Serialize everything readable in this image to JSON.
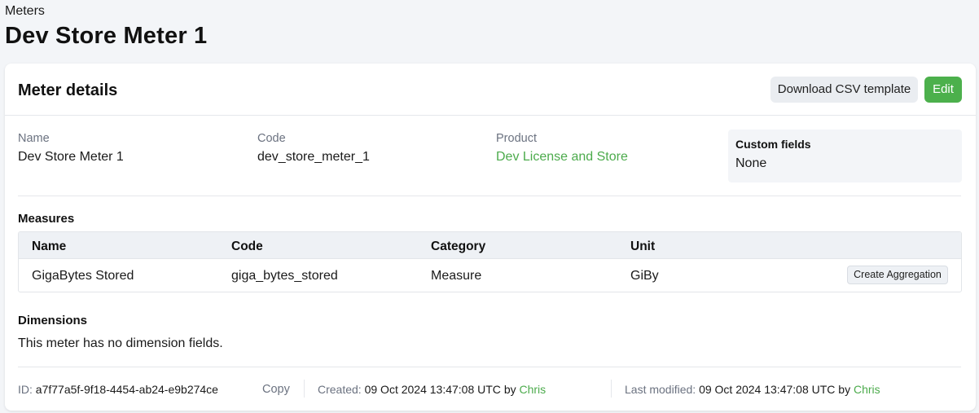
{
  "breadcrumb": "Meters",
  "page_title": "Dev Store Meter 1",
  "card": {
    "title": "Meter details",
    "download_button": "Download CSV template",
    "edit_button": "Edit"
  },
  "fields": {
    "name_label": "Name",
    "name_value": "Dev Store Meter 1",
    "code_label": "Code",
    "code_value": "dev_store_meter_1",
    "product_label": "Product",
    "product_value": "Dev License and Store"
  },
  "custom_fields": {
    "title": "Custom fields",
    "value": "None"
  },
  "measures": {
    "title": "Measures",
    "columns": [
      "Name",
      "Code",
      "Category",
      "Unit"
    ],
    "rows": [
      {
        "name": "GigaBytes Stored",
        "code": "giga_bytes_stored",
        "category": "Measure",
        "unit": "GiBy",
        "action": "Create Aggregation"
      }
    ]
  },
  "dimensions": {
    "title": "Dimensions",
    "empty_text": "This meter has no dimension fields."
  },
  "footer": {
    "id_label": "ID:",
    "id_value": "a7f77a5f-9f18-4454-ab24-e9b274ce",
    "copy": "Copy",
    "created_label": "Created:",
    "created_value": "09 Oct 2024 13:47:08 UTC",
    "by_word": "by",
    "created_by": "Chris",
    "modified_label": "Last modified:",
    "modified_value": "09 Oct 2024 13:47:08 UTC",
    "modified_by": "Chris"
  },
  "colors": {
    "accent_green": "#4cb04c",
    "link_green": "#4cab4c",
    "page_bg": "#f3f5f8",
    "muted_text": "#6b7280"
  }
}
